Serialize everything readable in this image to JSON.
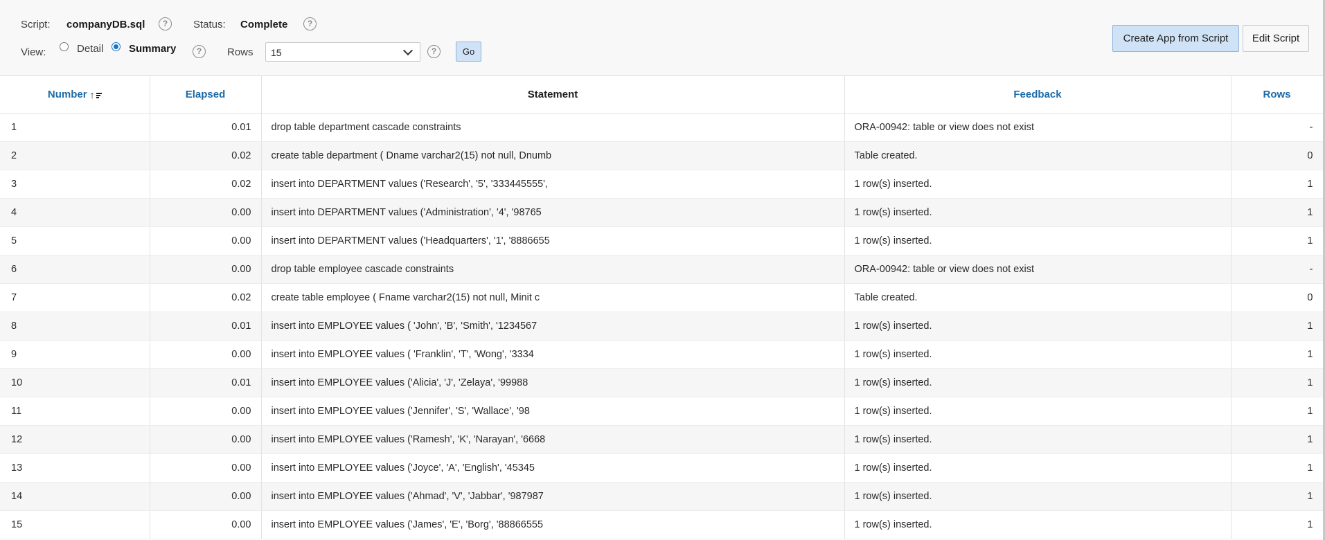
{
  "header": {
    "script_label": "Script:",
    "script_value": "companyDB.sql",
    "status_label": "Status:",
    "status_value": "Complete",
    "view_label": "View:",
    "view_options": [
      "Detail",
      "Summary"
    ],
    "view_selected": "Summary",
    "rows_label": "Rows",
    "rows_value": "15",
    "go_label": "Go",
    "help_glyph": "?",
    "create_app_label": "Create App from Script",
    "edit_script_label": "Edit Script"
  },
  "table": {
    "columns": {
      "number": "Number",
      "elapsed": "Elapsed",
      "statement": "Statement",
      "feedback": "Feedback",
      "rows": "Rows"
    },
    "sort": {
      "column": "Number",
      "direction": "ascending",
      "icon": "sort-ascending-icon"
    },
    "rows": [
      {
        "number": "1",
        "elapsed": "0.01",
        "statement": "drop table department cascade constraints",
        "feedback": "ORA-00942: table or view does not exist",
        "rows": "-"
      },
      {
        "number": "2",
        "elapsed": "0.02",
        "statement": "create table department ( Dname varchar2(15) not null, Dnumb",
        "feedback": "Table created.",
        "rows": "0"
      },
      {
        "number": "3",
        "elapsed": "0.02",
        "statement": "insert into DEPARTMENT values ('Research', '5', '333445555',",
        "feedback": "1 row(s) inserted.",
        "rows": "1"
      },
      {
        "number": "4",
        "elapsed": "0.00",
        "statement": "insert into DEPARTMENT values ('Administration', '4', '98765",
        "feedback": "1 row(s) inserted.",
        "rows": "1"
      },
      {
        "number": "5",
        "elapsed": "0.00",
        "statement": "insert into DEPARTMENT values ('Headquarters', '1', '8886655",
        "feedback": "1 row(s) inserted.",
        "rows": "1"
      },
      {
        "number": "6",
        "elapsed": "0.00",
        "statement": "drop table employee cascade constraints",
        "feedback": "ORA-00942: table or view does not exist",
        "rows": "-"
      },
      {
        "number": "7",
        "elapsed": "0.02",
        "statement": "create table employee ( Fname varchar2(15) not null, Minit c",
        "feedback": "Table created.",
        "rows": "0"
      },
      {
        "number": "8",
        "elapsed": "0.01",
        "statement": "insert into EMPLOYEE values ( 'John', 'B', 'Smith', '1234567",
        "feedback": "1 row(s) inserted.",
        "rows": "1"
      },
      {
        "number": "9",
        "elapsed": "0.00",
        "statement": "insert into EMPLOYEE values ( 'Franklin', 'T', 'Wong', '3334",
        "feedback": "1 row(s) inserted.",
        "rows": "1"
      },
      {
        "number": "10",
        "elapsed": "0.01",
        "statement": "insert into EMPLOYEE values ('Alicia', 'J', 'Zelaya', '99988",
        "feedback": "1 row(s) inserted.",
        "rows": "1"
      },
      {
        "number": "11",
        "elapsed": "0.00",
        "statement": "insert into EMPLOYEE values ('Jennifer', 'S', 'Wallace', '98",
        "feedback": "1 row(s) inserted.",
        "rows": "1"
      },
      {
        "number": "12",
        "elapsed": "0.00",
        "statement": "insert into EMPLOYEE values ('Ramesh', 'K', 'Narayan', '6668",
        "feedback": "1 row(s) inserted.",
        "rows": "1"
      },
      {
        "number": "13",
        "elapsed": "0.00",
        "statement": "insert into EMPLOYEE values ('Joyce', 'A', 'English', '45345",
        "feedback": "1 row(s) inserted.",
        "rows": "1"
      },
      {
        "number": "14",
        "elapsed": "0.00",
        "statement": "insert into EMPLOYEE values ('Ahmad', 'V', 'Jabbar', '987987",
        "feedback": "1 row(s) inserted.",
        "rows": "1"
      },
      {
        "number": "15",
        "elapsed": "0.00",
        "statement": "insert into EMPLOYEE values ('James', 'E', 'Borg', '88866555",
        "feedback": "1 row(s) inserted.",
        "rows": "1"
      }
    ]
  },
  "colors": {
    "link": "#1c6aa8",
    "button_primary_bg": "#cfe2f6",
    "header_bg": "#f8f8f8",
    "row_alt_bg": "#f6f6f6"
  }
}
